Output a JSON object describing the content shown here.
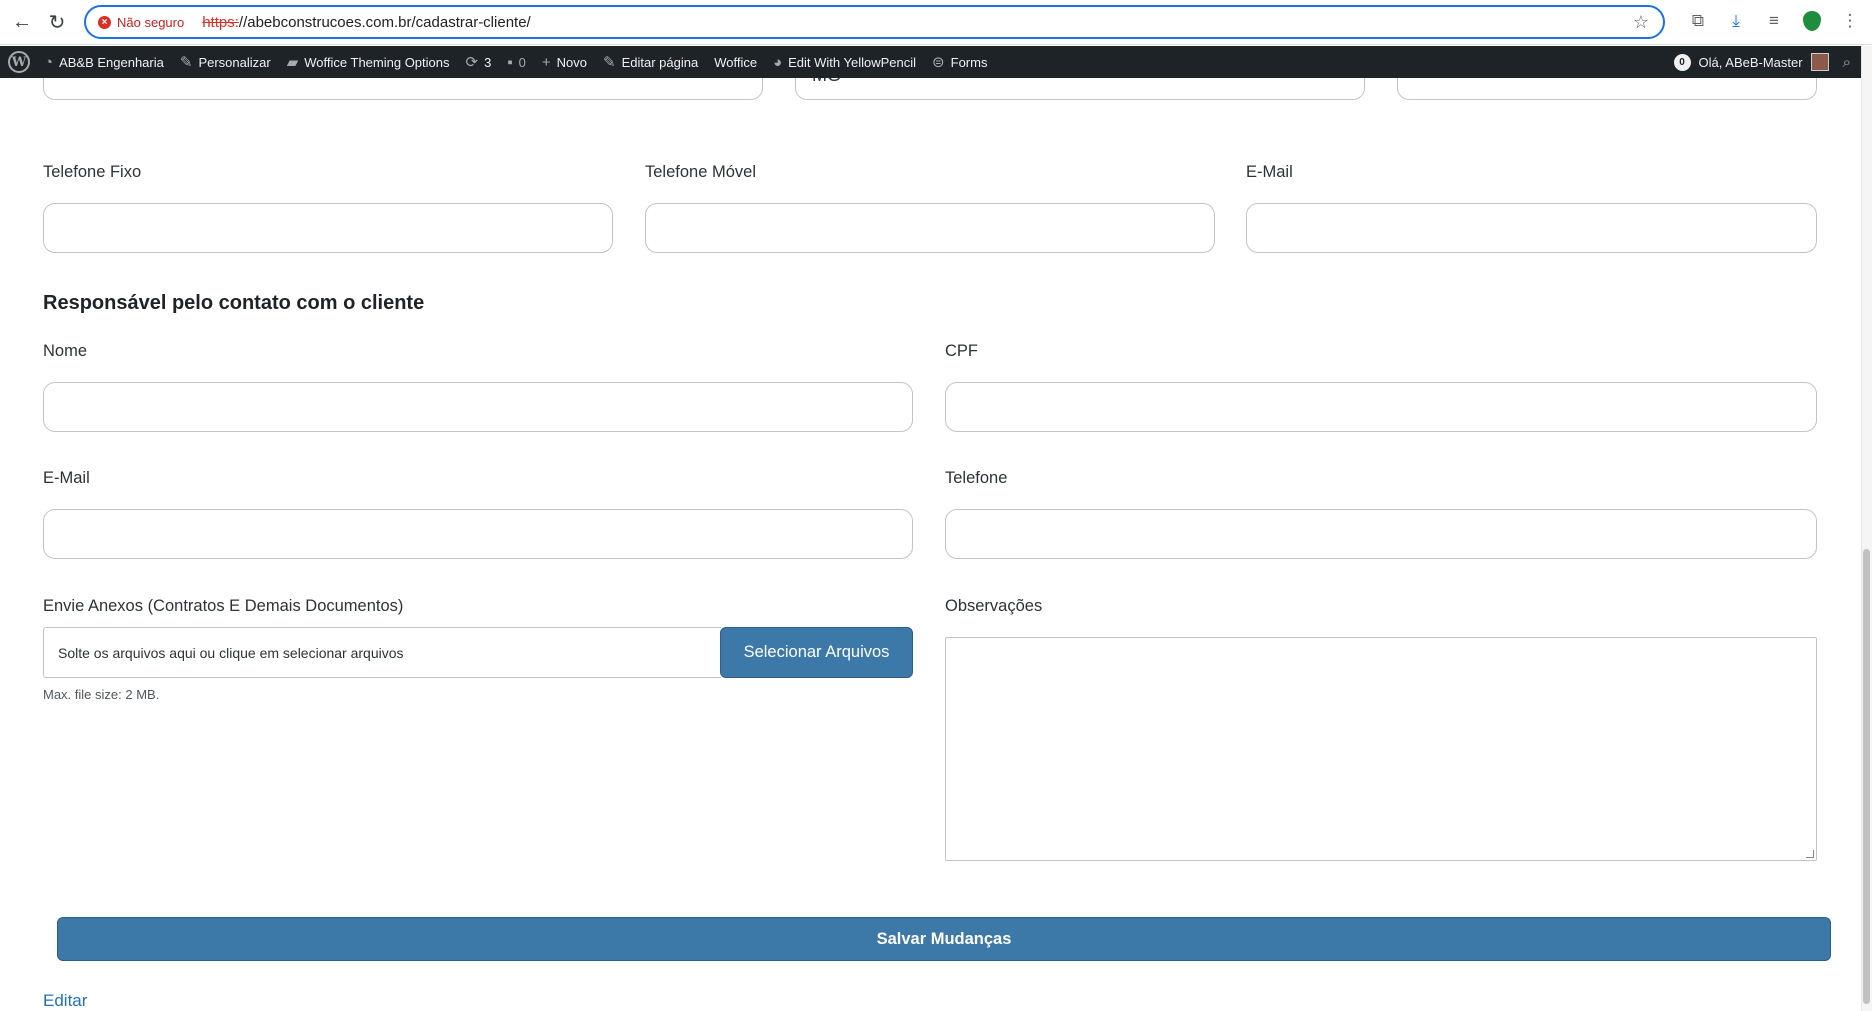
{
  "browser": {
    "security_label": "Não seguro",
    "url_scheme": "https:",
    "url_rest": "//abebconstrucoes.com.br/cadastrar-cliente/"
  },
  "adminbar": {
    "site_name": "AB&B Engenharia",
    "customize": "Personalizar",
    "theme_options": "Woffice Theming Options",
    "updates_count": "3",
    "comments_count": "0",
    "new_label": "Novo",
    "edit_page": "Editar página",
    "woffice": "Woffice",
    "yellowpencil": "Edit With YellowPencil",
    "forms": "Forms",
    "notifications_count": "0",
    "greeting": "Olá, ABeB-Master"
  },
  "form": {
    "state_value": "MG",
    "telefone_fixo_label": "Telefone Fixo",
    "telefone_movel_label": "Telefone Móvel",
    "email_label": "E-Mail",
    "section_title": "Responsável pelo contato com o cliente",
    "nome_label": "Nome",
    "cpf_label": "CPF",
    "contact_email_label": "E-Mail",
    "telefone_label": "Telefone",
    "anexos_label": "Envie Anexos (Contratos E Demais Documentos)",
    "dropzone_text": "Solte os arquivos aqui ou clique em selecionar arquivos",
    "select_files_button": "Selecionar Arquivos",
    "max_file_size": "Max. file size: 2 MB.",
    "observacoes_label": "Observações",
    "save_button": "Salvar Mudanças",
    "edit_link": "Editar"
  }
}
